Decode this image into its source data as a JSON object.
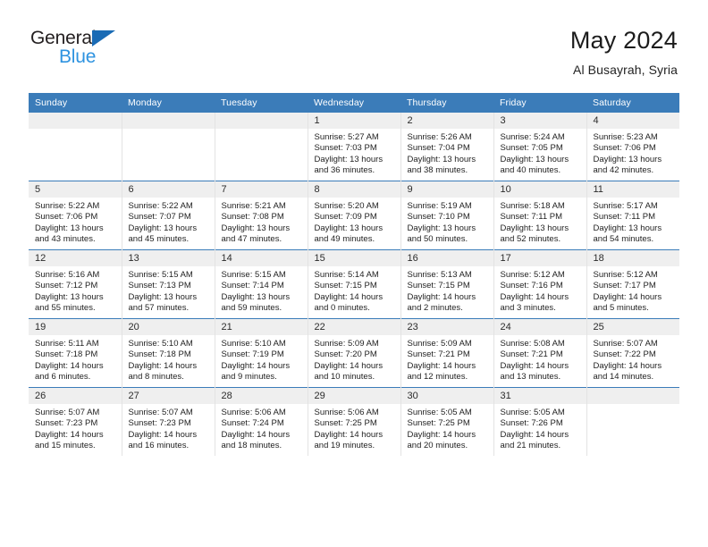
{
  "brand": {
    "name_top": "General",
    "name_bottom": "Blue",
    "triangle_color": "#1a6bb5",
    "blue_text_color": "#2e93e0"
  },
  "header": {
    "title": "May 2024",
    "subtitle": "Al Busayrah, Syria"
  },
  "theme": {
    "header_blue": "#3b7cb9",
    "daynum_gray": "#efefef",
    "cell_border": "#e3e3e3"
  },
  "weekday_headers": [
    "Sunday",
    "Monday",
    "Tuesday",
    "Wednesday",
    "Thursday",
    "Friday",
    "Saturday"
  ],
  "weeks": [
    [
      {
        "day": "",
        "sunrise": "",
        "sunset": "",
        "daylight_l1": "",
        "daylight_l2": ""
      },
      {
        "day": "",
        "sunrise": "",
        "sunset": "",
        "daylight_l1": "",
        "daylight_l2": ""
      },
      {
        "day": "",
        "sunrise": "",
        "sunset": "",
        "daylight_l1": "",
        "daylight_l2": ""
      },
      {
        "day": "1",
        "sunrise": "Sunrise: 5:27 AM",
        "sunset": "Sunset: 7:03 PM",
        "daylight_l1": "Daylight: 13 hours",
        "daylight_l2": "and 36 minutes."
      },
      {
        "day": "2",
        "sunrise": "Sunrise: 5:26 AM",
        "sunset": "Sunset: 7:04 PM",
        "daylight_l1": "Daylight: 13 hours",
        "daylight_l2": "and 38 minutes."
      },
      {
        "day": "3",
        "sunrise": "Sunrise: 5:24 AM",
        "sunset": "Sunset: 7:05 PM",
        "daylight_l1": "Daylight: 13 hours",
        "daylight_l2": "and 40 minutes."
      },
      {
        "day": "4",
        "sunrise": "Sunrise: 5:23 AM",
        "sunset": "Sunset: 7:06 PM",
        "daylight_l1": "Daylight: 13 hours",
        "daylight_l2": "and 42 minutes."
      }
    ],
    [
      {
        "day": "5",
        "sunrise": "Sunrise: 5:22 AM",
        "sunset": "Sunset: 7:06 PM",
        "daylight_l1": "Daylight: 13 hours",
        "daylight_l2": "and 43 minutes."
      },
      {
        "day": "6",
        "sunrise": "Sunrise: 5:22 AM",
        "sunset": "Sunset: 7:07 PM",
        "daylight_l1": "Daylight: 13 hours",
        "daylight_l2": "and 45 minutes."
      },
      {
        "day": "7",
        "sunrise": "Sunrise: 5:21 AM",
        "sunset": "Sunset: 7:08 PM",
        "daylight_l1": "Daylight: 13 hours",
        "daylight_l2": "and 47 minutes."
      },
      {
        "day": "8",
        "sunrise": "Sunrise: 5:20 AM",
        "sunset": "Sunset: 7:09 PM",
        "daylight_l1": "Daylight: 13 hours",
        "daylight_l2": "and 49 minutes."
      },
      {
        "day": "9",
        "sunrise": "Sunrise: 5:19 AM",
        "sunset": "Sunset: 7:10 PM",
        "daylight_l1": "Daylight: 13 hours",
        "daylight_l2": "and 50 minutes."
      },
      {
        "day": "10",
        "sunrise": "Sunrise: 5:18 AM",
        "sunset": "Sunset: 7:11 PM",
        "daylight_l1": "Daylight: 13 hours",
        "daylight_l2": "and 52 minutes."
      },
      {
        "day": "11",
        "sunrise": "Sunrise: 5:17 AM",
        "sunset": "Sunset: 7:11 PM",
        "daylight_l1": "Daylight: 13 hours",
        "daylight_l2": "and 54 minutes."
      }
    ],
    [
      {
        "day": "12",
        "sunrise": "Sunrise: 5:16 AM",
        "sunset": "Sunset: 7:12 PM",
        "daylight_l1": "Daylight: 13 hours",
        "daylight_l2": "and 55 minutes."
      },
      {
        "day": "13",
        "sunrise": "Sunrise: 5:15 AM",
        "sunset": "Sunset: 7:13 PM",
        "daylight_l1": "Daylight: 13 hours",
        "daylight_l2": "and 57 minutes."
      },
      {
        "day": "14",
        "sunrise": "Sunrise: 5:15 AM",
        "sunset": "Sunset: 7:14 PM",
        "daylight_l1": "Daylight: 13 hours",
        "daylight_l2": "and 59 minutes."
      },
      {
        "day": "15",
        "sunrise": "Sunrise: 5:14 AM",
        "sunset": "Sunset: 7:15 PM",
        "daylight_l1": "Daylight: 14 hours",
        "daylight_l2": "and 0 minutes."
      },
      {
        "day": "16",
        "sunrise": "Sunrise: 5:13 AM",
        "sunset": "Sunset: 7:15 PM",
        "daylight_l1": "Daylight: 14 hours",
        "daylight_l2": "and 2 minutes."
      },
      {
        "day": "17",
        "sunrise": "Sunrise: 5:12 AM",
        "sunset": "Sunset: 7:16 PM",
        "daylight_l1": "Daylight: 14 hours",
        "daylight_l2": "and 3 minutes."
      },
      {
        "day": "18",
        "sunrise": "Sunrise: 5:12 AM",
        "sunset": "Sunset: 7:17 PM",
        "daylight_l1": "Daylight: 14 hours",
        "daylight_l2": "and 5 minutes."
      }
    ],
    [
      {
        "day": "19",
        "sunrise": "Sunrise: 5:11 AM",
        "sunset": "Sunset: 7:18 PM",
        "daylight_l1": "Daylight: 14 hours",
        "daylight_l2": "and 6 minutes."
      },
      {
        "day": "20",
        "sunrise": "Sunrise: 5:10 AM",
        "sunset": "Sunset: 7:18 PM",
        "daylight_l1": "Daylight: 14 hours",
        "daylight_l2": "and 8 minutes."
      },
      {
        "day": "21",
        "sunrise": "Sunrise: 5:10 AM",
        "sunset": "Sunset: 7:19 PM",
        "daylight_l1": "Daylight: 14 hours",
        "daylight_l2": "and 9 minutes."
      },
      {
        "day": "22",
        "sunrise": "Sunrise: 5:09 AM",
        "sunset": "Sunset: 7:20 PM",
        "daylight_l1": "Daylight: 14 hours",
        "daylight_l2": "and 10 minutes."
      },
      {
        "day": "23",
        "sunrise": "Sunrise: 5:09 AM",
        "sunset": "Sunset: 7:21 PM",
        "daylight_l1": "Daylight: 14 hours",
        "daylight_l2": "and 12 minutes."
      },
      {
        "day": "24",
        "sunrise": "Sunrise: 5:08 AM",
        "sunset": "Sunset: 7:21 PM",
        "daylight_l1": "Daylight: 14 hours",
        "daylight_l2": "and 13 minutes."
      },
      {
        "day": "25",
        "sunrise": "Sunrise: 5:07 AM",
        "sunset": "Sunset: 7:22 PM",
        "daylight_l1": "Daylight: 14 hours",
        "daylight_l2": "and 14 minutes."
      }
    ],
    [
      {
        "day": "26",
        "sunrise": "Sunrise: 5:07 AM",
        "sunset": "Sunset: 7:23 PM",
        "daylight_l1": "Daylight: 14 hours",
        "daylight_l2": "and 15 minutes."
      },
      {
        "day": "27",
        "sunrise": "Sunrise: 5:07 AM",
        "sunset": "Sunset: 7:23 PM",
        "daylight_l1": "Daylight: 14 hours",
        "daylight_l2": "and 16 minutes."
      },
      {
        "day": "28",
        "sunrise": "Sunrise: 5:06 AM",
        "sunset": "Sunset: 7:24 PM",
        "daylight_l1": "Daylight: 14 hours",
        "daylight_l2": "and 18 minutes."
      },
      {
        "day": "29",
        "sunrise": "Sunrise: 5:06 AM",
        "sunset": "Sunset: 7:25 PM",
        "daylight_l1": "Daylight: 14 hours",
        "daylight_l2": "and 19 minutes."
      },
      {
        "day": "30",
        "sunrise": "Sunrise: 5:05 AM",
        "sunset": "Sunset: 7:25 PM",
        "daylight_l1": "Daylight: 14 hours",
        "daylight_l2": "and 20 minutes."
      },
      {
        "day": "31",
        "sunrise": "Sunrise: 5:05 AM",
        "sunset": "Sunset: 7:26 PM",
        "daylight_l1": "Daylight: 14 hours",
        "daylight_l2": "and 21 minutes."
      },
      {
        "day": "",
        "sunrise": "",
        "sunset": "",
        "daylight_l1": "",
        "daylight_l2": ""
      }
    ]
  ]
}
